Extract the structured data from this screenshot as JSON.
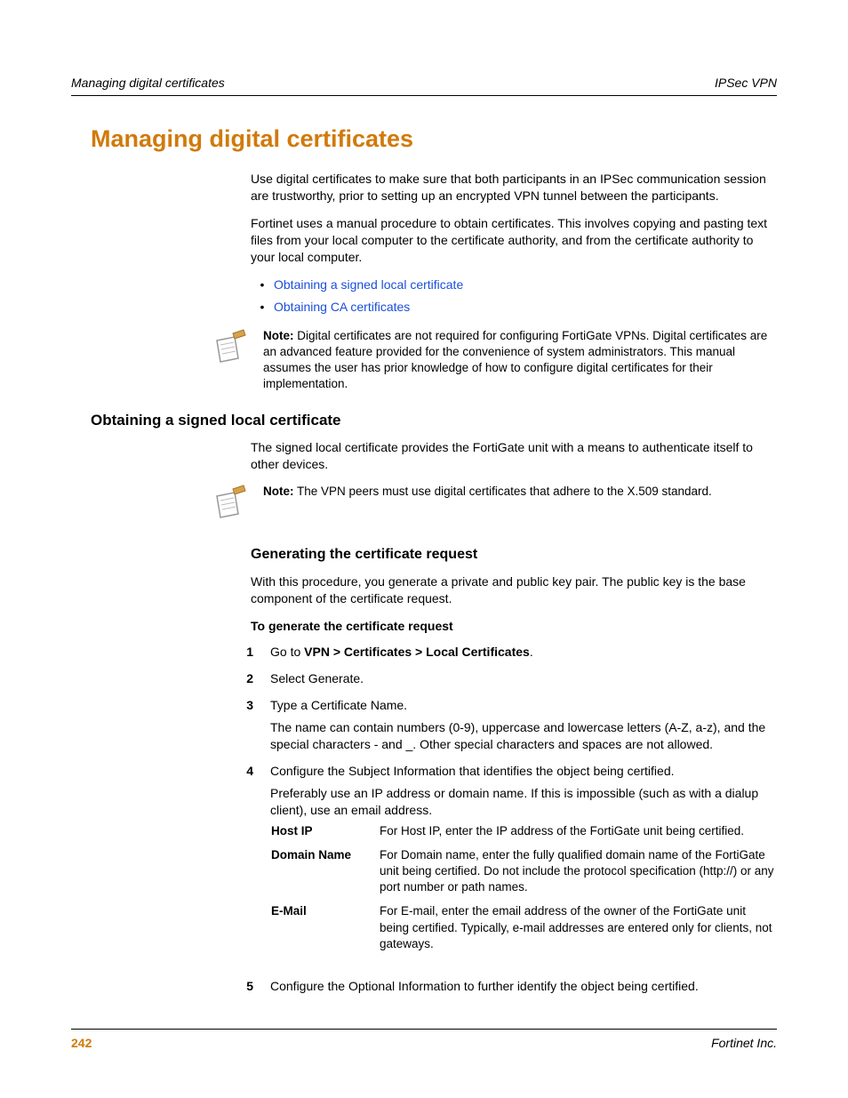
{
  "header": {
    "left": "Managing digital certificates",
    "right": "IPSec VPN"
  },
  "title": "Managing digital certificates",
  "intro1": "Use digital certificates to make sure that both participants in an IPSec communication session are trustworthy, prior to setting up an encrypted VPN tunnel between the participants.",
  "intro2": "Fortinet uses a manual procedure to obtain certificates. This involves copying and pasting text files from your local computer to the certificate authority, and from the certificate authority to your local computer.",
  "links": {
    "a": "Obtaining a signed local certificate",
    "b": "Obtaining CA certificates"
  },
  "note1": {
    "label": "Note:",
    "text": " Digital certificates are not required for configuring FortiGate VPNs. Digital certificates are an advanced feature provided for the convenience of system administrators. This manual assumes the user has prior knowledge of how to configure digital certificates for their implementation."
  },
  "h2a": "Obtaining a signed local certificate",
  "p_h2a": "The signed local certificate provides the FortiGate unit with a means to authenticate itself to other devices.",
  "note2": {
    "label": "Note:",
    "text": " The VPN peers must use digital certificates that adhere to the X.509 standard."
  },
  "h3a": "Generating the certificate request",
  "p_h3a": "With this procedure, you generate a private and public key pair. The public key is the base component of the certificate request.",
  "steps_title": "To generate the certificate request",
  "steps": {
    "s1": {
      "n": "1",
      "pre": "Go to ",
      "b": "VPN > Certificates > Local Certificates",
      "post": "."
    },
    "s2": {
      "n": "2",
      "t": "Select Generate."
    },
    "s3": {
      "n": "3",
      "t1": "Type a Certificate Name.",
      "t2": "The name can contain numbers (0-9), uppercase and lowercase letters (A-Z, a-z), and the special characters - and _. Other special characters and spaces are not allowed."
    },
    "s4": {
      "n": "4",
      "t1": "Configure the Subject Information that identifies the object being certified.",
      "t2": "Preferably use an IP address or domain name. If this is impossible (such as with a dialup client), use an email address."
    },
    "s5": {
      "n": "5",
      "t": "Configure the Optional Information to further identify the object being certified."
    }
  },
  "subject": {
    "r1": {
      "k": "Host IP",
      "v": "For Host IP, enter the IP address of the FortiGate unit being certified."
    },
    "r2": {
      "k": "Domain Name",
      "v": "For Domain name, enter the fully qualified domain name of the FortiGate unit being certified. Do not include the protocol specification (http://) or any port number or path names."
    },
    "r3": {
      "k": "E-Mail",
      "v": "For E-mail, enter the email address of the owner of the FortiGate unit being certified. Typically, e-mail addresses are entered only for clients, not gateways."
    }
  },
  "footer": {
    "page": "242",
    "company": "Fortinet Inc."
  }
}
